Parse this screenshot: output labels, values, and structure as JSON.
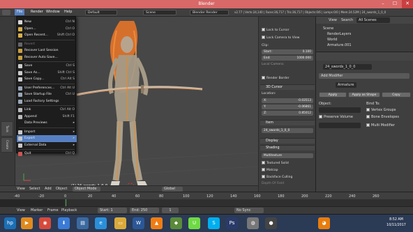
{
  "window": {
    "title": "Blender",
    "minimize": "–",
    "maximize": "☐",
    "close": "✕"
  },
  "info_header": {
    "menus": [
      "File",
      "Render",
      "Window",
      "Help"
    ],
    "layout": "Default",
    "scene": "Scene",
    "engine": "Blender Render",
    "stats": "v2.77 | Verts:24,140 | Faces:36,717 | Tris:36,717 | Objects:0/6 | Lamps:0/0 | Mem:24.52M | 24_swords_1_0_0"
  },
  "file_menu": {
    "items": [
      {
        "label": "New",
        "shortcut": "Ctrl N",
        "icon": "new-file-icon",
        "color": "#d8d8d8"
      },
      {
        "label": "Open...",
        "shortcut": "Ctrl O",
        "icon": "folder-icon",
        "color": "#d8b04a"
      },
      {
        "label": "Open Recent...",
        "shortcut": "Shift Ctrl O",
        "icon": "recent-icon",
        "color": "#d8b04a"
      },
      {
        "label": "Revert",
        "shortcut": "",
        "icon": "revert-icon",
        "color": "#666",
        "disabled": true
      },
      {
        "label": "Recover Last Session",
        "shortcut": "",
        "icon": "recover-icon",
        "color": "#c8a040"
      },
      {
        "label": "Recover Auto Save...",
        "shortcut": "",
        "icon": "recover-auto-icon",
        "color": "#c8a040"
      },
      {
        "label": "Save",
        "shortcut": "Ctrl S",
        "icon": "save-icon",
        "color": "#cccccc"
      },
      {
        "label": "Save As...",
        "shortcut": "Shift Ctrl S",
        "icon": "save-as-icon",
        "color": "#cccccc"
      },
      {
        "label": "Save Copy...",
        "shortcut": "Ctrl Alt S",
        "icon": "save-copy-icon",
        "color": "#cccccc"
      },
      {
        "label": "User Preferences...",
        "shortcut": "Ctrl Alt U",
        "icon": "preferences-icon",
        "color": "#9aa7b8"
      },
      {
        "label": "Save Startup File",
        "shortcut": "Ctrl U",
        "icon": "startup-icon",
        "color": "#9aa7b8"
      },
      {
        "label": "Load Factory Settings",
        "shortcut": "",
        "icon": "factory-icon",
        "color": "#9aa7b8"
      },
      {
        "label": "Link",
        "shortcut": "Ctrl Alt O",
        "icon": "link-icon",
        "color": "#bbbbbb"
      },
      {
        "label": "Append",
        "shortcut": "Shift F1",
        "icon": "append-icon",
        "color": "#bbbbbb"
      },
      {
        "label": "Data Previews",
        "shortcut": "▸",
        "icon": "",
        "color": ""
      },
      {
        "label": "Import",
        "shortcut": "▸",
        "icon": "import-icon",
        "color": "#c7c7c7"
      },
      {
        "label": "Export",
        "shortcut": "▸",
        "icon": "export-icon",
        "color": "#c7c7c7",
        "active": true
      },
      {
        "label": "External Data",
        "shortcut": "▸",
        "icon": "external-data-icon",
        "color": "#c7c7c7"
      },
      {
        "label": "Quit",
        "shortcut": "Ctrl Q",
        "icon": "quit-icon",
        "color": "#cc5555"
      }
    ]
  },
  "viewport": {
    "object_label": "(1) 24_swords_1_0_0",
    "mode": "Object Mode",
    "orientation": "Global"
  },
  "npanel": {
    "lock_cursor": "Lock to Cursor",
    "lock_camera": "Lock Camera to View",
    "clip_label": "Clip:",
    "clip_start_label": "Start:",
    "clip_start": "0.100",
    "clip_end_label": "End:",
    "clip_end": "1000.000",
    "local_camera": "Local Camera:",
    "render_border": "Render Border",
    "cursor_header": "3D Cursor",
    "location_label": "Location:",
    "x_label": "X:",
    "x": "-0.03513",
    "y_label": "Y:",
    "y": "-0.06861",
    "z_label": "Z:",
    "z": "0.85012",
    "item_header": "Item",
    "item_name": "24_swords_1_0_0",
    "display_header": "Display",
    "shading_header": "Shading",
    "shading_mode": "Multitexture",
    "textured_solid": "Textured Solid",
    "matcap": "Matcap",
    "backface": "Backface Culling",
    "depth_of_field": "Depth Of Field"
  },
  "outliner": {
    "view": "View",
    "search": "Search",
    "scenes": "All Scenes",
    "rows": [
      "Scene",
      "RenderLayers",
      "World",
      "Armature.001"
    ]
  },
  "properties": {
    "object_name": "24_swords_1_0_0",
    "add_modifier": "Add Modifier",
    "modifier_name": "Armature",
    "apply": "Apply",
    "apply_shape": "Apply as Shape",
    "copy": "Copy",
    "object_label": "Object:",
    "bind_to": "Bind To:",
    "vertex_groups": "Vertex Groups",
    "preserve_volume": "Preserve Volume",
    "bone_envelopes": "Bone Envelopes",
    "multi_modifier": "Multi Modifier"
  },
  "timeline": {
    "menus": [
      "View",
      "Marker",
      "Frame",
      "Playback"
    ],
    "start_label": "Start:",
    "start": "1",
    "end_label": "End:",
    "end": "250",
    "current": "1",
    "sync": "No Sync",
    "ticks": [
      "-40",
      "-20",
      "0",
      "20",
      "40",
      "60",
      "80",
      "100",
      "120",
      "140",
      "160",
      "180",
      "200",
      "220",
      "240",
      "260"
    ],
    "view_menus": [
      "View",
      "Select",
      "Add",
      "Object"
    ]
  },
  "taskbar": {
    "time": "8:52 AM",
    "date": "10/11/2017",
    "icons": [
      {
        "name": "hp-icon",
        "glyph": "hp",
        "color": "#1b6fb5"
      },
      {
        "name": "media-player-icon",
        "glyph": "▶",
        "color": "#e08a1e"
      },
      {
        "name": "chrome-icon",
        "glyph": "◉",
        "color": "#d64a3b"
      },
      {
        "name": "download-icon",
        "glyph": "⬇",
        "color": "#3a7bd5"
      },
      {
        "name": "explorer-icon",
        "glyph": "▤",
        "color": "#3b6aa0"
      },
      {
        "name": "ie-icon",
        "glyph": "e",
        "color": "#2a8fd8"
      },
      {
        "name": "folder-icon",
        "glyph": "▭",
        "color": "#d9a93a"
      },
      {
        "name": "word-icon",
        "glyph": "W",
        "color": "#2b5797"
      },
      {
        "name": "vlc-icon",
        "glyph": "▲",
        "color": "#ef7d13"
      },
      {
        "name": "app-icon",
        "glyph": "◆",
        "color": "#5a8a3a"
      },
      {
        "name": "upwork-icon",
        "glyph": "U",
        "color": "#6fda44"
      },
      {
        "name": "skype-icon",
        "glyph": "S",
        "color": "#00aff0"
      },
      {
        "name": "photoshop-icon",
        "glyph": "Ps",
        "color": "#2a3b6a"
      },
      {
        "name": "camera-icon",
        "glyph": "◍",
        "color": "#777"
      },
      {
        "name": "obs-icon",
        "glyph": "●",
        "color": "#444"
      },
      {
        "name": "blender-icon",
        "glyph": "◕",
        "color": "#e87d0d"
      }
    ]
  }
}
